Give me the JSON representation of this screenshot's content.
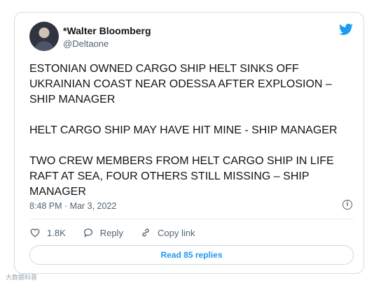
{
  "author": {
    "name": "*Walter Bloomberg",
    "handle": "@Deltaone"
  },
  "tweet": {
    "paragraphs": [
      "ESTONIAN OWNED CARGO SHIP HELT SINKS OFF UKRAINIAN COAST NEAR ODESSA AFTER EXPLOSION – SHIP MANAGER",
      "HELT CARGO SHIP MAY HAVE HIT MINE - SHIP MANAGER",
      "TWO CREW MEMBERS FROM HELT CARGO SHIP IN LIFE RAFT AT SEA, FOUR OTHERS STILL MISSING – SHIP MANAGER"
    ],
    "timestamp": "8:48 PM · Mar 3, 2022"
  },
  "actions": {
    "like_count": "1.8K",
    "reply_label": "Reply",
    "copy_label": "Copy link"
  },
  "read_replies_label": "Read 85 replies",
  "watermark": "大数据科普",
  "icons": {
    "brand": "twitter-bird-icon",
    "info": "info-icon",
    "like": "heart-icon",
    "reply": "speech-bubble-icon",
    "copy": "link-icon"
  },
  "colors": {
    "accent": "#1d9bf0",
    "text": "#0f1419",
    "secondary": "#536471"
  }
}
